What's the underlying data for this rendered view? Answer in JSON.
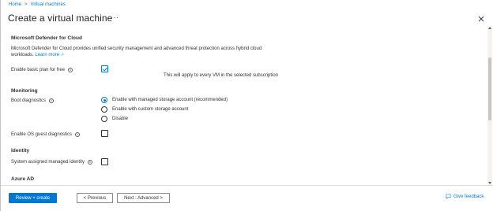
{
  "breadcrumb": {
    "items": [
      "Home",
      "Virtual machines"
    ],
    "separator": ">"
  },
  "header": {
    "title": "Create a virtual machine",
    "more_label": "···"
  },
  "sections": {
    "defender": {
      "title": "Microsoft Defender for Cloud",
      "description": "Microsoft Defender for Cloud provides unified security management and advanced threat protection across hybrid cloud workloads.",
      "learn_more": "Learn more",
      "enable_basic_label": "Enable basic plan for free",
      "enable_basic_checked": true,
      "enable_basic_note": "This will apply to every VM in the selected subscription"
    },
    "monitoring": {
      "title": "Monitoring",
      "boot_diagnostics_label": "Boot diagnostics",
      "boot_options": [
        {
          "label": "Enable with managed storage account (recommended)",
          "selected": true
        },
        {
          "label": "Enable with custom storage account",
          "selected": false
        },
        {
          "label": "Disable",
          "selected": false
        }
      ],
      "os_guest_label": "Enable OS guest diagnostics",
      "os_guest_checked": false
    },
    "identity": {
      "title": "Identity",
      "managed_identity_label": "System assigned managed identity",
      "managed_identity_checked": false
    },
    "azure_ad": {
      "title": "Azure AD"
    }
  },
  "footer": {
    "review_create_label": "Review + create",
    "previous_label": "< Previous",
    "next_label": "Next : Advanced >",
    "feedback_label": "Give feedback"
  },
  "icons": {
    "info": "info-icon",
    "close": "close-icon",
    "external_link": "external-link-icon",
    "feedback": "feedback-icon"
  },
  "colors": {
    "accent": "#0078d4",
    "text": "#323130",
    "border": "#8a8886"
  }
}
